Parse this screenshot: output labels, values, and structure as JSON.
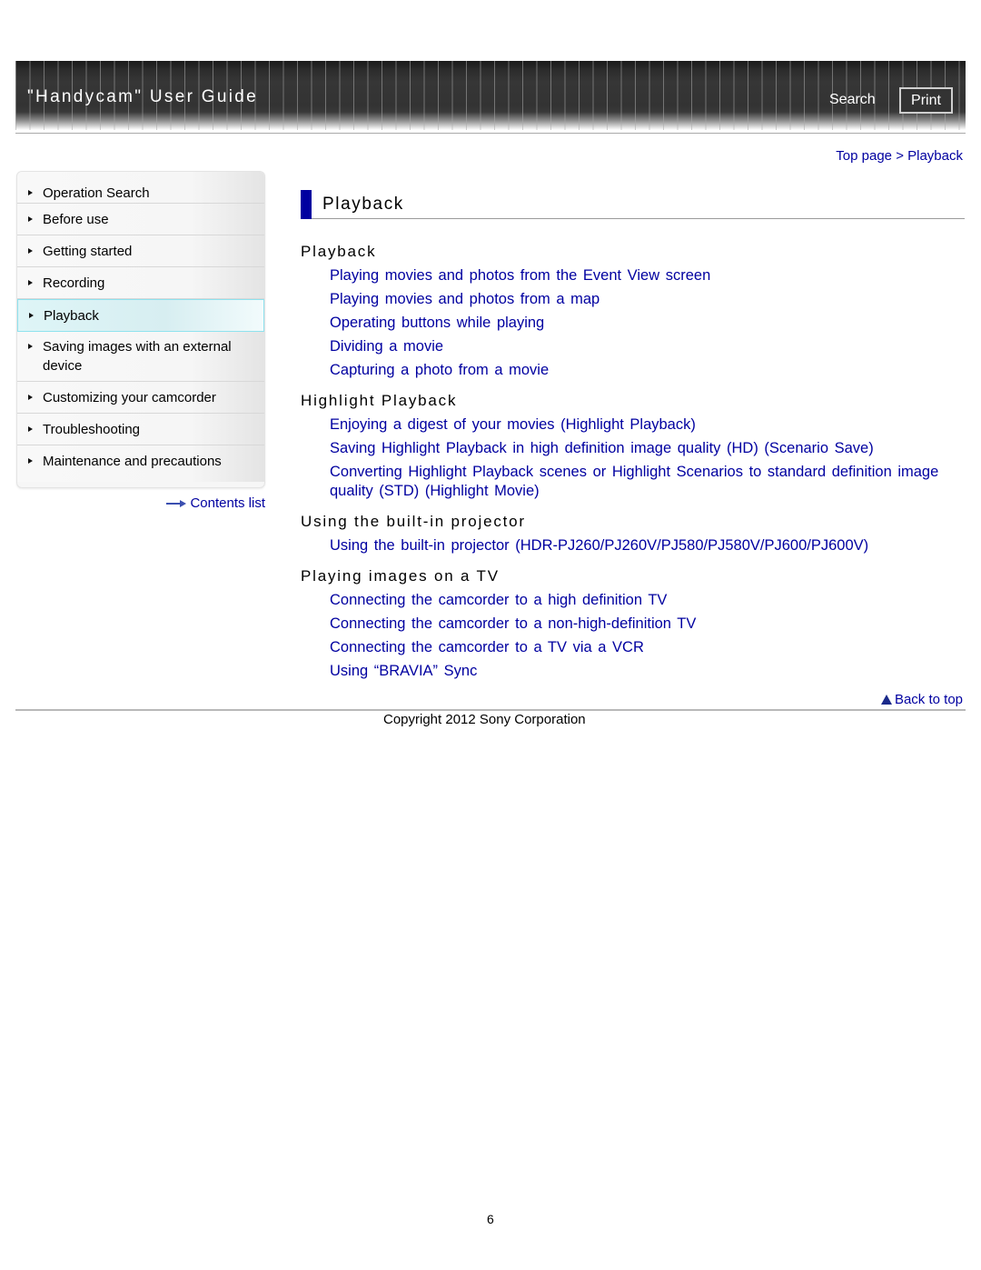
{
  "header": {
    "title": "\"Handycam\" User Guide",
    "search_label": "Search",
    "print_label": "Print"
  },
  "breadcrumb": {
    "items": [
      "Top page",
      "Playback"
    ],
    "separator": ">"
  },
  "sidebar": {
    "items": [
      {
        "label": "Operation Search",
        "active": false
      },
      {
        "label": "Before use",
        "active": false
      },
      {
        "label": "Getting started",
        "active": false
      },
      {
        "label": "Recording",
        "active": false
      },
      {
        "label": "Playback",
        "active": true
      },
      {
        "label": "Saving images with an external device",
        "active": false
      },
      {
        "label": "Customizing your camcorder",
        "active": false
      },
      {
        "label": "Troubleshooting",
        "active": false
      },
      {
        "label": "Maintenance and precautions",
        "active": false
      }
    ],
    "contents_list_label": "Contents list"
  },
  "main": {
    "heading": "Playback",
    "sections": [
      {
        "title": "Playback",
        "links": [
          "Playing movies and photos from the Event View screen",
          "Playing movies and photos from a map",
          "Operating buttons while playing",
          "Dividing a movie",
          "Capturing a photo from a movie"
        ]
      },
      {
        "title": "Highlight Playback",
        "links": [
          "Enjoying a digest of your movies (Highlight Playback)",
          "Saving Highlight Playback in high definition image quality (HD) (Scenario Save)",
          "Converting Highlight Playback scenes or Highlight Scenarios to standard definition image quality (STD) (Highlight Movie)"
        ]
      },
      {
        "title": "Using the built-in projector",
        "links": [
          "Using the built-in projector (HDR-PJ260/PJ260V/PJ580/PJ580V/PJ600/PJ600V)"
        ]
      },
      {
        "title": "Playing images on a TV",
        "links": [
          "Connecting the camcorder to a high definition TV",
          "Connecting the camcorder to a non-high-definition TV",
          "Connecting the camcorder to a TV via a VCR",
          "Using “BRAVIA” Sync"
        ]
      }
    ],
    "back_to_top_label": "Back to top"
  },
  "footer": {
    "copyright": "Copyright 2012 Sony Corporation",
    "page_number": "6"
  },
  "colors": {
    "link": "#0000a0",
    "accent_bar": "#0000a0",
    "active_nav_border": "#8fe2ee"
  }
}
